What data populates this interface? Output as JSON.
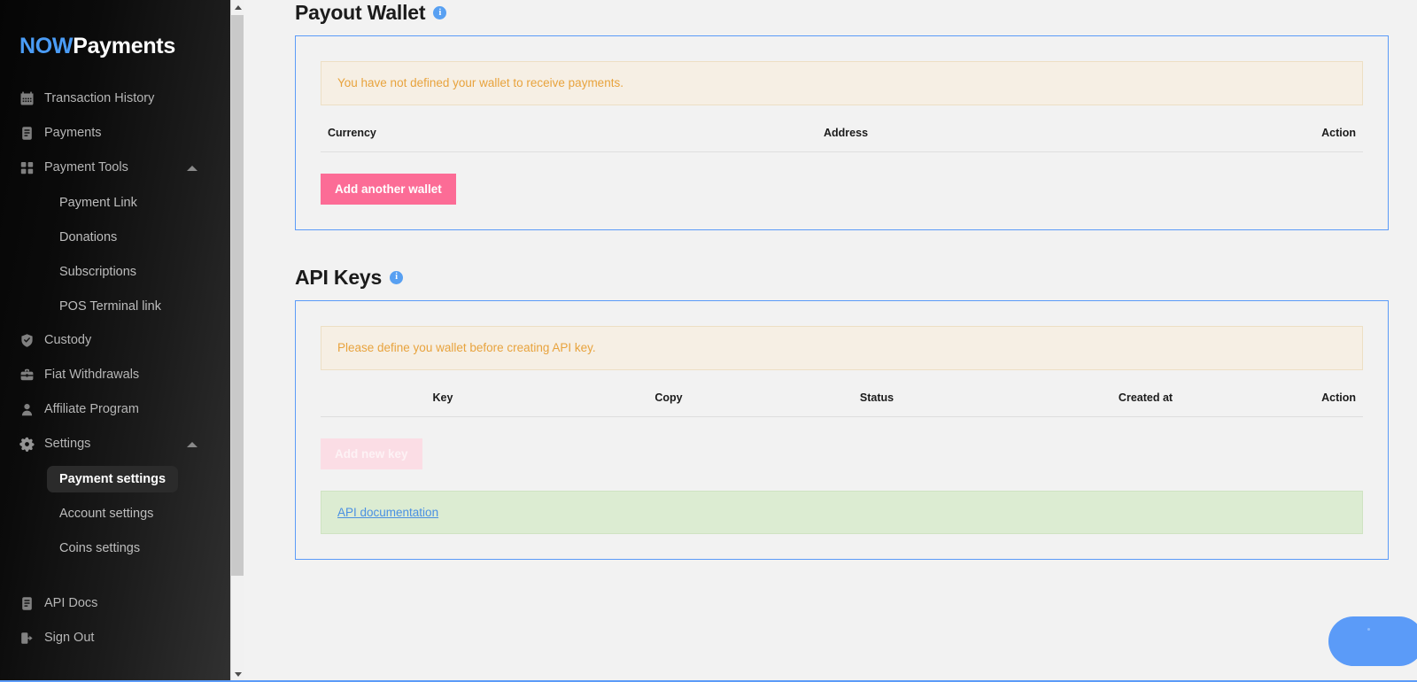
{
  "brand": {
    "part1": "NOW",
    "part2": "Payments",
    "color_now": "#4a9cf6"
  },
  "sidebar": {
    "items": [
      {
        "label": "Transaction History",
        "icon": "calendar-icon",
        "type": "item"
      },
      {
        "label": "Payments",
        "icon": "document-icon",
        "type": "item"
      },
      {
        "label": "Payment Tools",
        "icon": "grid-icon",
        "type": "group",
        "expanded": true
      },
      {
        "label": "Payment Link",
        "type": "sub"
      },
      {
        "label": "Donations",
        "type": "sub"
      },
      {
        "label": "Subscriptions",
        "type": "sub"
      },
      {
        "label": "POS Terminal link",
        "type": "sub"
      },
      {
        "label": "Custody",
        "icon": "shield-check-icon",
        "type": "item"
      },
      {
        "label": "Fiat Withdrawals",
        "icon": "briefcase-icon",
        "type": "item"
      },
      {
        "label": "Affiliate Program",
        "icon": "person-icon",
        "type": "item"
      },
      {
        "label": "Settings",
        "icon": "gear-icon",
        "type": "group",
        "expanded": true
      },
      {
        "label": "Payment settings",
        "type": "sub",
        "active": true
      },
      {
        "label": "Account settings",
        "type": "sub"
      },
      {
        "label": "Coins settings",
        "type": "sub"
      },
      {
        "label": "API Docs",
        "icon": "document-icon",
        "type": "item"
      },
      {
        "label": "Sign Out",
        "icon": "sign-out-icon",
        "type": "item"
      }
    ]
  },
  "payout_wallet": {
    "title": "Payout Wallet",
    "info_glyph": "i",
    "alert": "You have not defined your wallet to receive payments.",
    "columns": [
      "Currency",
      "Address",
      "Action"
    ],
    "rows": [],
    "add_button": "Add another wallet",
    "accent": "#fc6c96",
    "border": "#5b9bf8"
  },
  "api_keys": {
    "title": "API Keys",
    "info_glyph": "i",
    "alert": "Please define you wallet before creating API key.",
    "columns": [
      "Key",
      "Copy",
      "Status",
      "Created at",
      "Action"
    ],
    "rows": [],
    "add_button": "Add new key",
    "add_button_disabled": true,
    "doc_link": "API documentation",
    "doc_link_color": "#4a90e2"
  },
  "chat_widget": {
    "name": "chat-bubble",
    "color": "#5b9bf8"
  }
}
